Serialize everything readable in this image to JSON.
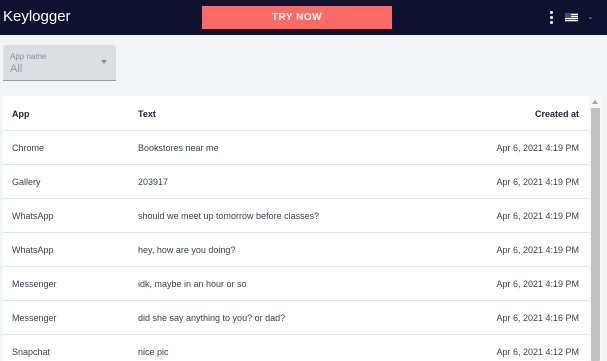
{
  "header": {
    "title": "Keylogger",
    "try_button_label": "TRY NOW",
    "menu_icon": "more-vertical-icon",
    "language_flag": "us-flag-icon",
    "background_color": "#0e1230",
    "accent_color": "#fb6b64"
  },
  "filter": {
    "label": "App name",
    "value": "All"
  },
  "table": {
    "columns": {
      "app": "App",
      "text": "Text",
      "created": "Created at"
    },
    "rows": [
      {
        "app": "Chrome",
        "text": "Bookstores near me",
        "created": "Apr 6, 2021 4:19 PM"
      },
      {
        "app": "Gallery",
        "text": "203917",
        "created": "Apr 6, 2021 4:19 PM"
      },
      {
        "app": "WhatsApp",
        "text": "should we meet up tomorrow before classes?",
        "created": "Apr 6, 2021 4:19 PM"
      },
      {
        "app": "WhatsApp",
        "text": "hey, how are you doing?",
        "created": "Apr 6, 2021 4:19 PM"
      },
      {
        "app": "Messenger",
        "text": "idk, maybe in an hour or so",
        "created": "Apr 6, 2021 4:19 PM"
      },
      {
        "app": "Messenger",
        "text": "did she say anything to you? or dad?",
        "created": "Apr 6, 2021 4:16 PM"
      },
      {
        "app": "Snapchat",
        "text": "nice pic",
        "created": "Apr 6, 2021 4:12 PM"
      }
    ]
  }
}
